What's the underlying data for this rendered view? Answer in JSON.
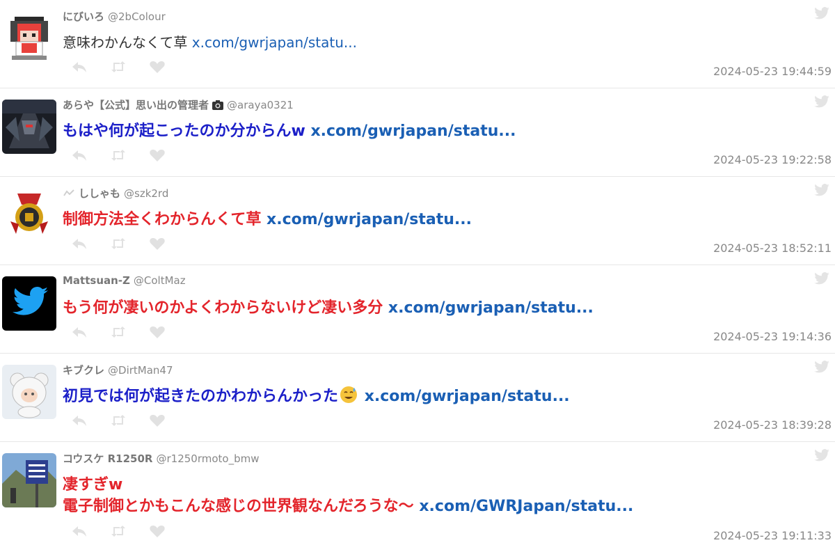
{
  "colors": {
    "name": "#777777",
    "link": "#1a5fb4",
    "blue_text": "#1b1fc8",
    "red_text": "#e3242b",
    "timestamp": "#888888",
    "action_icon": "#e1e1e1"
  },
  "tweets": [
    {
      "name": "にびいろ",
      "handle": "@2bColour",
      "text_lines": [
        "意味わかんなくて草"
      ],
      "link": "x.com/gwrjapan/statu...",
      "timestamp": "2024-05-23 19:44:59",
      "style": "plain"
    },
    {
      "name": "あらや【公式】思い出の管理者",
      "handle": "@araya0321",
      "text_lines": [
        "もはや何が起こったのか分からんw"
      ],
      "link": "x.com/gwrjapan/statu...",
      "timestamp": "2024-05-23 19:22:58",
      "style": "blue"
    },
    {
      "name": "ししゃも",
      "handle": "@szk2rd",
      "text_lines": [
        "制御方法全くわからんくて草"
      ],
      "link": "x.com/gwrjapan/statu...",
      "timestamp": "2024-05-23 18:52:11",
      "style": "red"
    },
    {
      "name": "Mattsuan-Z",
      "handle": "@ColtMaz",
      "text_lines": [
        "もう何が凄いのかよくわからないけど凄い多分"
      ],
      "link": "x.com/gwrjapan/statu...",
      "timestamp": "2024-05-23 19:14:36",
      "style": "red"
    },
    {
      "name": "キブクレ",
      "handle": "@DirtMan47",
      "text_lines": [
        "初見では何が起きたのかわからんかった"
      ],
      "link": "x.com/gwrjapan/statu...",
      "timestamp": "2024-05-23 18:39:28",
      "style": "blue"
    },
    {
      "name": "コウスケ R1250R",
      "handle": "@r1250rmoto_bmw",
      "text_lines": [
        "凄すぎw",
        "電子制御とかもこんな感じの世界観なんだろうな〜"
      ],
      "link": "x.com/GWRJapan/statu...",
      "timestamp": "2024-05-23 19:11:33",
      "style": "red"
    }
  ]
}
